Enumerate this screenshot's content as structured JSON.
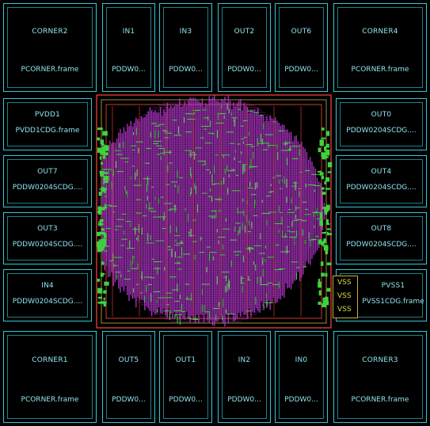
{
  "title": "",
  "colors": {
    "background": "#000000",
    "pad_border": "#35c6d6",
    "label": "#8fe3ee",
    "routing_magenta": "#c03ad8",
    "routing_green": "#3fd23f",
    "routing_red": "#c83a30",
    "vss_yellow": "#d8d84a"
  },
  "corners": {
    "top_left": {
      "name": "CORNER2",
      "cell": "PCORNER.frame"
    },
    "top_right": {
      "name": "CORNER4",
      "cell": "PCORNER.frame"
    },
    "bottom_left": {
      "name": "CORNER1",
      "cell": "PCORNER.frame"
    },
    "bottom_right": {
      "name": "CORNER3",
      "cell": "PCORNER.frame"
    }
  },
  "top_pads": [
    {
      "name": "IN1",
      "cell": "PDDW0..."
    },
    {
      "name": "IN3",
      "cell": "PDDW0..."
    },
    {
      "name": "OUT2",
      "cell": "PDDW0..."
    },
    {
      "name": "OUT6",
      "cell": "PDDW0..."
    }
  ],
  "bottom_pads": [
    {
      "name": "OUT5",
      "cell": "PDDW0..."
    },
    {
      "name": "OUT1",
      "cell": "PDDW0..."
    },
    {
      "name": "IN2",
      "cell": "PDDW0..."
    },
    {
      "name": "IN0",
      "cell": "PDDW0..."
    }
  ],
  "left_pads": [
    {
      "name": "PVDD1",
      "cell": "PVDD1CDG.frame"
    },
    {
      "name": "OUT7",
      "cell": "PDDW0204SCDG...."
    },
    {
      "name": "OUT3",
      "cell": "PDDW0204SCDG...."
    },
    {
      "name": "IN4",
      "cell": "PDDW0204SCDG...."
    }
  ],
  "right_pads": [
    {
      "name": "OUT0",
      "cell": "PDDW0204SCDG...."
    },
    {
      "name": "OUT4",
      "cell": "PDDW0204SCDG...."
    },
    {
      "name": "OUT8",
      "cell": "PDDW0204SCDG...."
    },
    {
      "name": "PVSS1",
      "cell": "PVSS1CDG.frame"
    }
  ],
  "vss_labels": [
    "VSS",
    "VSS",
    "VSS"
  ]
}
